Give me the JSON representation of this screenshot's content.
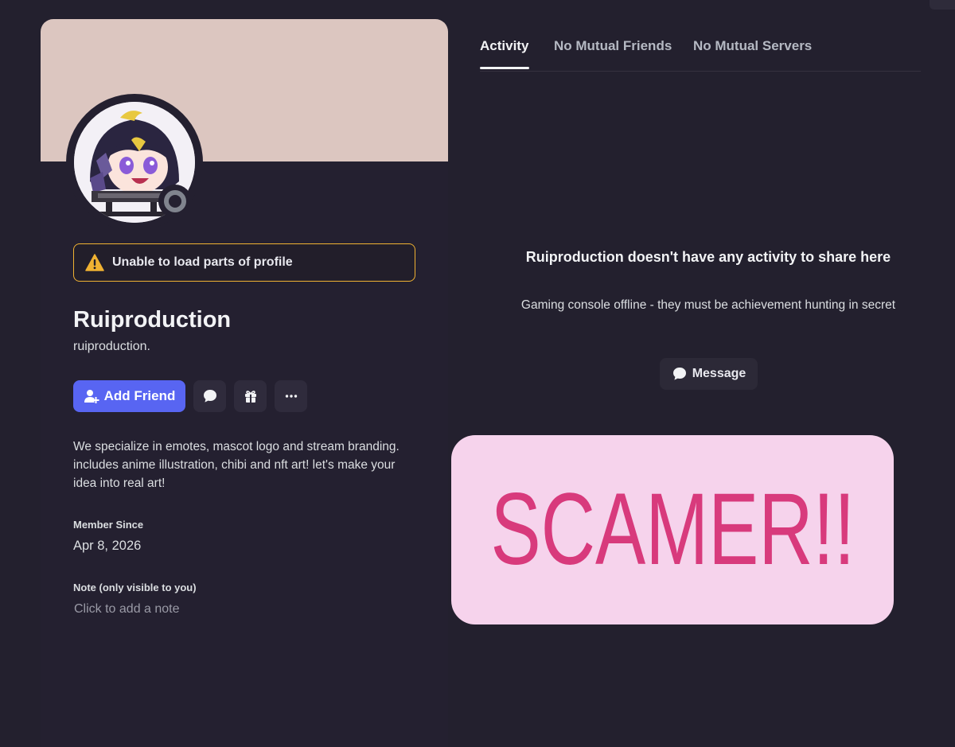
{
  "profile": {
    "display_name": "Ruiproduction",
    "username": "ruiproduction.",
    "banner_color": "#dcc6c0",
    "status": "offline",
    "warning": "Unable to load parts of profile",
    "actions": {
      "add_friend": "Add Friend",
      "message_icon": "chat-bubble-icon",
      "gift_icon": "gift-icon",
      "more_icon": "ellipsis-icon"
    },
    "bio": "We specialize in emotes, mascot logo and stream branding. includes anime illustration, chibi and nft art! let's make your idea into real art!",
    "member_since_label": "Member Since",
    "member_since": "Apr 8, 2026",
    "note_label": "Note (only visible to you)",
    "note_placeholder": "Click to add a note"
  },
  "tabs": [
    {
      "label": "Activity",
      "active": true
    },
    {
      "label": "No Mutual Friends",
      "active": false
    },
    {
      "label": "No Mutual Servers",
      "active": false
    }
  ],
  "activity": {
    "empty_title": "Ruiproduction doesn't have any activity to share here",
    "empty_subtitle": "Gaming console offline - they must be achievement hunting in secret",
    "message_button": "Message"
  },
  "sticker": {
    "text": "SCAMER!!",
    "background": "#f6d3ec",
    "color": "#d83a7c"
  },
  "colors": {
    "background": "#23202e",
    "accent": "#5865f2",
    "warning": "#f0b232"
  }
}
